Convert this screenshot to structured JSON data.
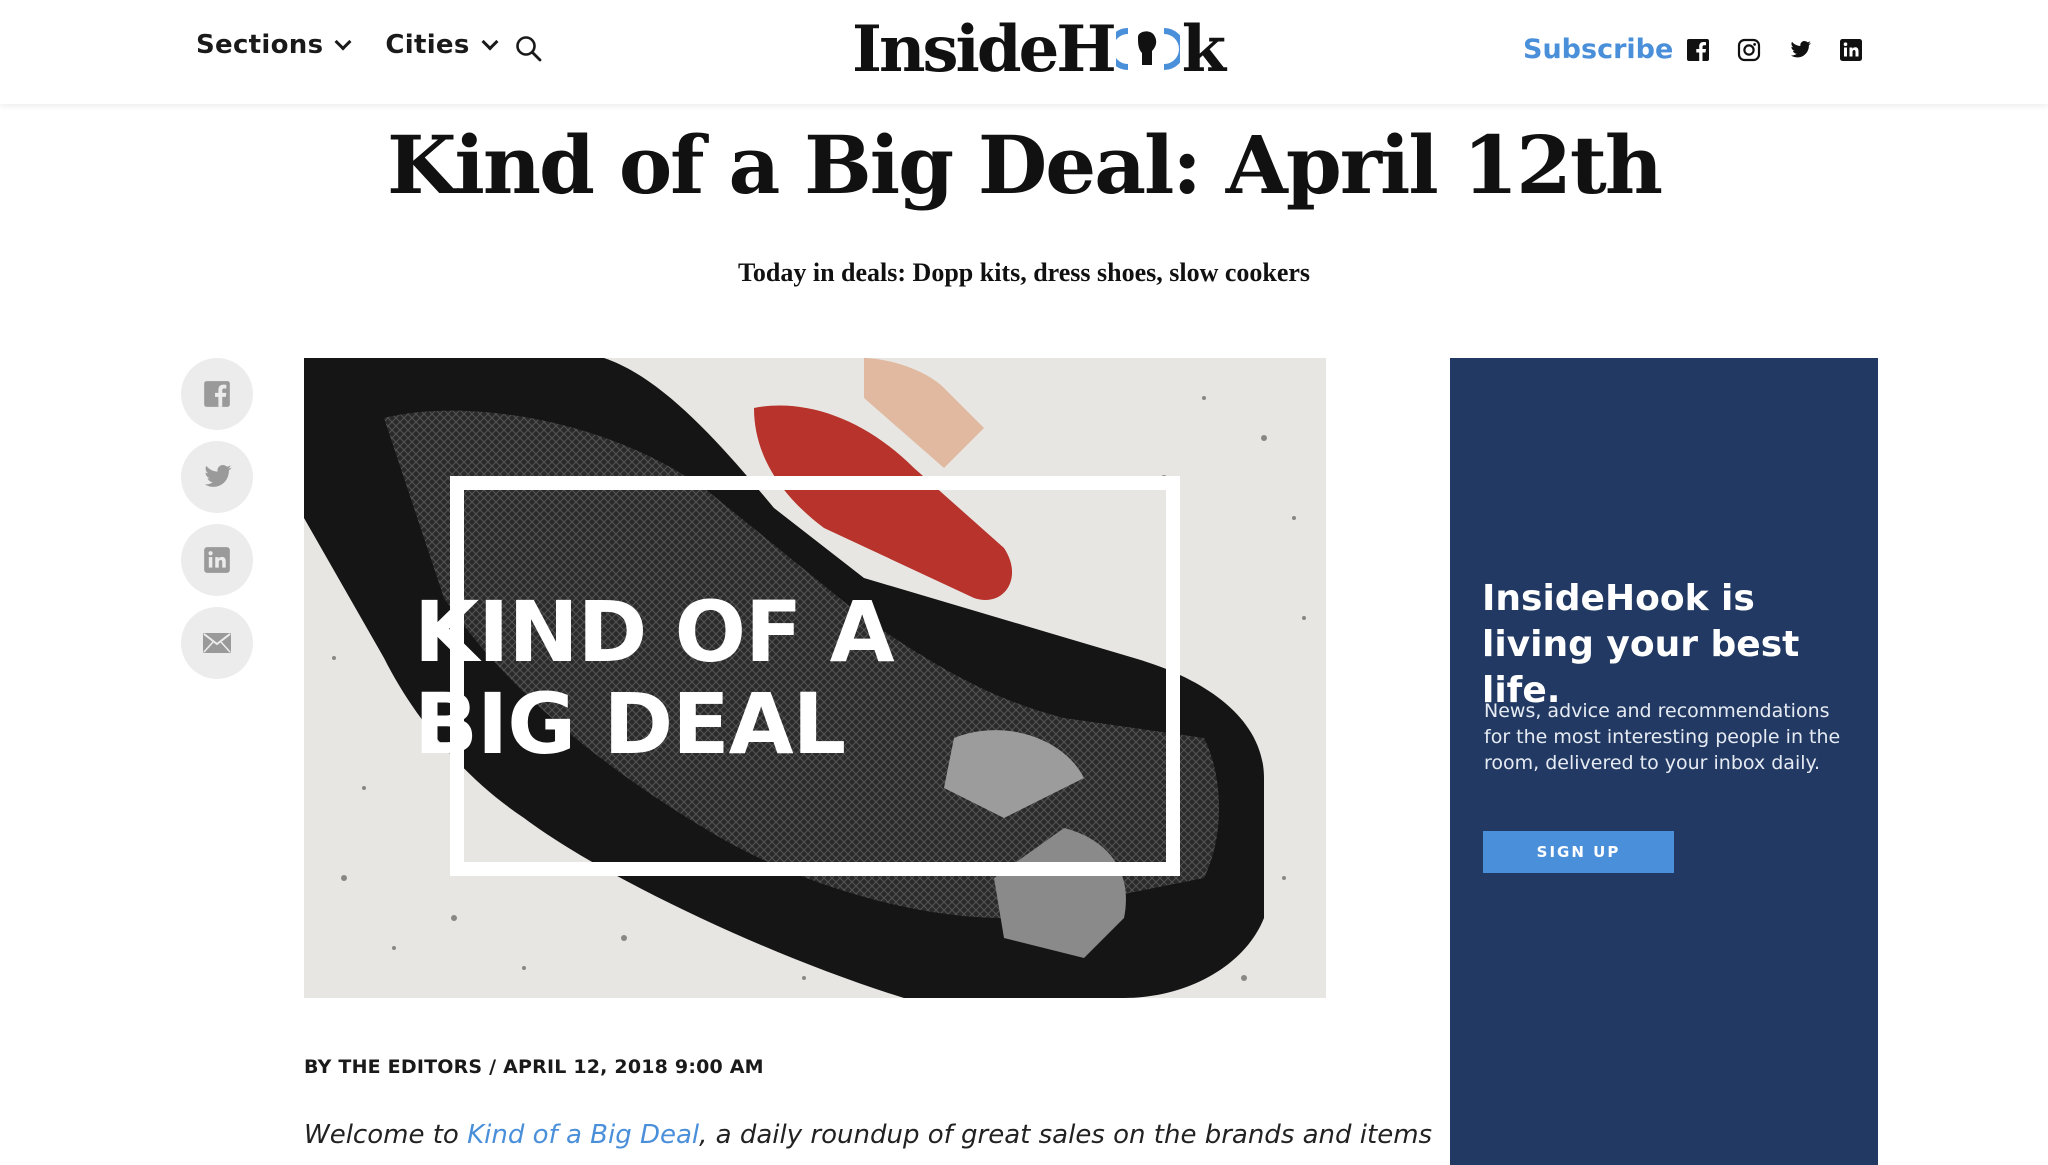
{
  "header": {
    "nav": [
      {
        "label": "Sections",
        "icon": "chevron-down-icon"
      },
      {
        "label": "Cities",
        "icon": "chevron-down-icon"
      }
    ],
    "search_icon": "search-icon",
    "logo_left": "InsideH",
    "logo_right": "k",
    "subscribe_label": "Subscribe",
    "social": [
      "facebook-icon",
      "instagram-icon",
      "twitter-icon",
      "linkedin-icon"
    ]
  },
  "article": {
    "title": "Kind of a Big Deal: April 12th",
    "dek": "Today in deals: Dopp kits, dress shoes, slow cookers",
    "hero_line1": "KIND OF A",
    "hero_line2": "BIG DEAL",
    "byline": "BY THE EDITORS / APRIL 12, 2018 9:00 AM",
    "body_prefix": "Welcome to ",
    "body_link": "Kind of a Big Deal",
    "body_suffix": ", a daily roundup of great sales on the brands and items"
  },
  "share": [
    "facebook-icon",
    "twitter-icon",
    "linkedin-icon",
    "email-icon"
  ],
  "ad": {
    "title": "InsideHook is living your best life.",
    "text": "News, advice and recommendations for the most interesting people in the room, delivered to your inbox daily.",
    "button": "SIGN UP"
  },
  "colors": {
    "accent": "#4a8fd9",
    "ad_background": "#223a63",
    "share_bg": "#ececec"
  }
}
